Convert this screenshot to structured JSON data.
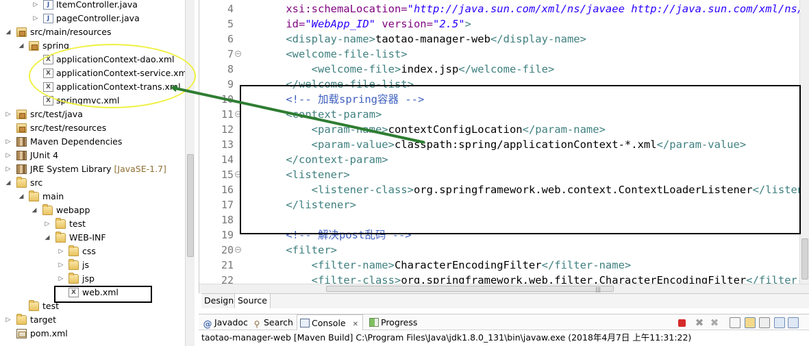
{
  "tree": {
    "items": [
      {
        "label": "ItemController.java",
        "decoration": ""
      },
      {
        "label": "pageController.java",
        "decoration": ""
      },
      {
        "label": "src/main/resources",
        "decoration": ""
      },
      {
        "label": "spring",
        "decoration": ""
      },
      {
        "label": "applicationContext-dao.xml",
        "decoration": ""
      },
      {
        "label": "applicationContext-service.xml",
        "decoration": ""
      },
      {
        "label": "applicationContext-trans.xml",
        "decoration": ""
      },
      {
        "label": "springmvc.xml",
        "decoration": ""
      },
      {
        "label": "src/test/java",
        "decoration": ""
      },
      {
        "label": "src/test/resources",
        "decoration": ""
      },
      {
        "label": "Maven Dependencies",
        "decoration": ""
      },
      {
        "label": "JUnit 4",
        "decoration": ""
      },
      {
        "label": "JRE System Library",
        "decoration": "[JavaSE-1.7]"
      },
      {
        "label": "src",
        "decoration": ""
      },
      {
        "label": "main",
        "decoration": ""
      },
      {
        "label": "webapp",
        "decoration": ""
      },
      {
        "label": "test",
        "decoration": ""
      },
      {
        "label": "WEB-INF",
        "decoration": ""
      },
      {
        "label": "css",
        "decoration": ""
      },
      {
        "label": "js",
        "decoration": ""
      },
      {
        "label": "jsp",
        "decoration": ""
      },
      {
        "label": "web.xml",
        "decoration": ""
      },
      {
        "label": "test",
        "decoration": ""
      },
      {
        "label": "target",
        "decoration": ""
      },
      {
        "label": "pom.xml",
        "decoration": ""
      }
    ]
  },
  "editor": {
    "line_numbers": [
      "4",
      "5",
      "6",
      "7",
      "8",
      "9",
      "10",
      "11",
      "12",
      "13",
      "14",
      "15",
      "16",
      "17",
      "18",
      "19",
      "20",
      "21",
      "22"
    ],
    "lines": [
      [
        {
          "c": "an",
          "s": "    xsi:schemaLocation="
        },
        {
          "c": "av",
          "s": "\"http://java.sun.com/xml/ns/javaee http://java.sun.com/xml/ns/"
        }
      ],
      [
        {
          "c": "an",
          "s": "    id="
        },
        {
          "c": "av",
          "s": "\"WebApp_ID\""
        },
        {
          "c": "an",
          "s": " version="
        },
        {
          "c": "av",
          "s": "\"2.5\""
        },
        {
          "c": "t",
          "s": ">"
        }
      ],
      [
        {
          "c": "t",
          "s": "    <display-name>"
        },
        {
          "c": "tx",
          "s": "taotao-manager-web"
        },
        {
          "c": "t",
          "s": "</display-name>"
        }
      ],
      [
        {
          "c": "t",
          "s": "    <welcome-file-list>"
        }
      ],
      [
        {
          "c": "t",
          "s": "        <welcome-file>"
        },
        {
          "c": "tx",
          "s": "index.jsp"
        },
        {
          "c": "t",
          "s": "</welcome-file>"
        }
      ],
      [
        {
          "c": "t",
          "s": "    </welcome-file-list>"
        }
      ],
      [
        {
          "c": "cm",
          "s": "    <!-- 加载spring容器 -->"
        }
      ],
      [
        {
          "c": "t",
          "s": "    <context-param>"
        }
      ],
      [
        {
          "c": "t",
          "s": "        <param-name>"
        },
        {
          "c": "tx",
          "s": "contextConfigLocation"
        },
        {
          "c": "t",
          "s": "</param-name>"
        }
      ],
      [
        {
          "c": "t",
          "s": "        <param-value>"
        },
        {
          "c": "tx",
          "s": "classpath:spring/applicationContext-*.xml"
        },
        {
          "c": "t",
          "s": "</param-value>"
        }
      ],
      [
        {
          "c": "t",
          "s": "    </context-param>"
        }
      ],
      [
        {
          "c": "t",
          "s": "    <listener>"
        }
      ],
      [
        {
          "c": "t",
          "s": "        <listener-class>"
        },
        {
          "c": "tx",
          "s": "org.springframework.web.context.ContextLoaderListener"
        },
        {
          "c": "t",
          "s": "</listener-class>"
        }
      ],
      [
        {
          "c": "t",
          "s": "    </listener>"
        }
      ],
      [
        {
          "c": "tx",
          "s": ""
        }
      ],
      [
        {
          "c": "cm",
          "s": "    <!-- 解决post乱码 -->"
        }
      ],
      [
        {
          "c": "t",
          "s": "    <filter>"
        }
      ],
      [
        {
          "c": "t",
          "s": "        <filter-name>"
        },
        {
          "c": "tx",
          "s": "CharacterEncodingFilter"
        },
        {
          "c": "t",
          "s": "</filter-name>"
        }
      ],
      [
        {
          "c": "t",
          "s": "        <filter-class>"
        },
        {
          "c": "tx",
          "s": "org.springframework.web.filter.CharacterEncodingFilter"
        },
        {
          "c": "t",
          "s": "</filter-class>"
        }
      ]
    ]
  },
  "editor_tabs": {
    "design": "Design",
    "source": "Source"
  },
  "console": {
    "tabs": {
      "javadoc": "Javadoc",
      "search": "Search",
      "console": "Console",
      "progress": "Progress"
    },
    "close_glyph": "✕",
    "output": "taotao-manager-web [Maven Build] C:\\Program Files\\Java\\jdk1.8.0_131\\bin\\javaw.exe (2018年4月7日 上午11:31:22)"
  },
  "colors": {
    "tag": "#3f7f7f",
    "attr_name": "#7f007f",
    "attr_value": "#2a00ff",
    "comment": "#3f5fbf",
    "annotation_yellow": "#f0f040",
    "annotation_green": "#2e7d32"
  }
}
